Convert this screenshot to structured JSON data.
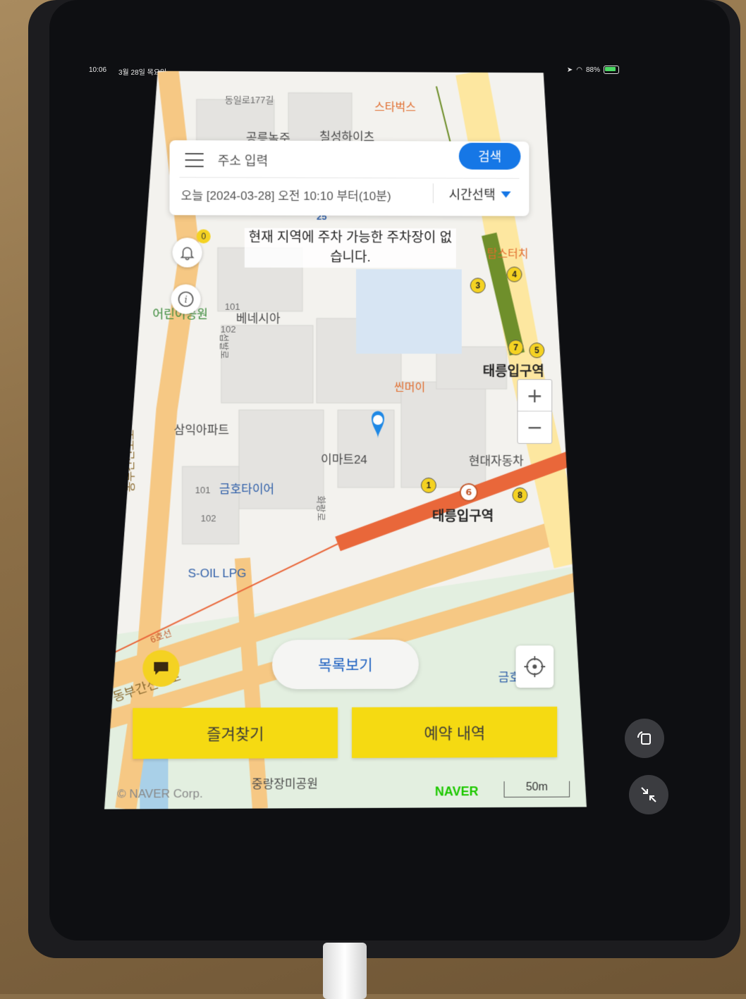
{
  "status_bar": {
    "time": "10:06",
    "date": "3월 28일 목요일",
    "battery": "88%"
  },
  "search": {
    "placeholder": "주소 입력",
    "button": "검색",
    "time_text": "오늘 [2024-03-28] 오전 10:10 부터(10분)",
    "time_select": "시간선택"
  },
  "notice": "현재 지역에 주차 가능한 주차장이 없습니다.",
  "notification_count": "0",
  "map_labels": {
    "roads": [
      "동일로177길",
      "섭발로",
      "화랑로",
      "동부간선도로",
      "6호선",
      "동부간선도로"
    ],
    "pois": [
      "공릉녹주",
      "칠성하이츠",
      "스타벅스",
      "베네시아",
      "삼익아파트",
      "금호타이어",
      "S-OIL LPG",
      "이마트24",
      "씬머이",
      "탑스터치",
      "현대자동차",
      "어린이공원",
      "중랑장미공원",
      "금호"
    ],
    "numbers": [
      "101",
      "102",
      "101",
      "102",
      "25"
    ],
    "stations": [
      "태릉입구역",
      "태릉입구역"
    ],
    "exits": [
      "3",
      "4",
      "7",
      "5",
      "1",
      "8"
    ],
    "line_badges": [
      "6",
      "7"
    ]
  },
  "zoom": {
    "in": "+",
    "out": "−"
  },
  "buttons": {
    "list_view": "목록보기",
    "favorites": "즐겨찾기",
    "reservations": "예약 내역"
  },
  "footer": {
    "copyright": "© NAVER Corp.",
    "brand": "NAVER",
    "scale": "50m"
  },
  "colors": {
    "accent_blue": "#1677e6",
    "yellow": "#f5da12",
    "subway_line6": "#e9673a",
    "subway_line7": "#6f8f2b"
  },
  "icons": [
    "menu-icon",
    "bell-icon",
    "info-icon",
    "zoom-in-icon",
    "zoom-out-icon",
    "locate-icon",
    "chat-icon",
    "location-pin-icon",
    "rotate-lock-icon",
    "collapse-icon"
  ]
}
